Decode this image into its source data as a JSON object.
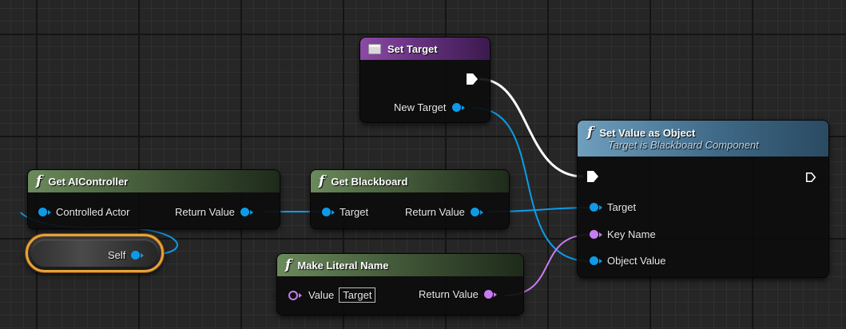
{
  "nodes": {
    "set_target": {
      "title": "Set Target",
      "pin_new_target": "New Target"
    },
    "set_value_as_object": {
      "title": "Set Value as Object",
      "subtitle": "Target is Blackboard Component",
      "pin_target": "Target",
      "pin_key_name": "Key Name",
      "pin_object_value": "Object Value"
    },
    "get_aicontroller": {
      "title": "Get AIController",
      "pin_controlled_actor": "Controlled Actor",
      "pin_return_value": "Return Value"
    },
    "get_blackboard": {
      "title": "Get Blackboard",
      "pin_target": "Target",
      "pin_return_value": "Return Value"
    },
    "make_literal_name": {
      "title": "Make Literal Name",
      "pin_value": "Value",
      "value_literal": "Target",
      "pin_return_value": "Return Value"
    },
    "self": {
      "label": "Self"
    }
  },
  "colors": {
    "object_pin": "#0d9be8",
    "name_pin": "#c77bf0",
    "exec_wire": "#ffffff",
    "function_header": "#3d5234",
    "variable_header": "#5e2d77",
    "blackboard_header": "#3f6a88",
    "self_outline": "#e8a236"
  },
  "icons": {
    "function": "f-function-icon",
    "variable": "variable-set-icon",
    "exec": "exec-pin-icon"
  }
}
